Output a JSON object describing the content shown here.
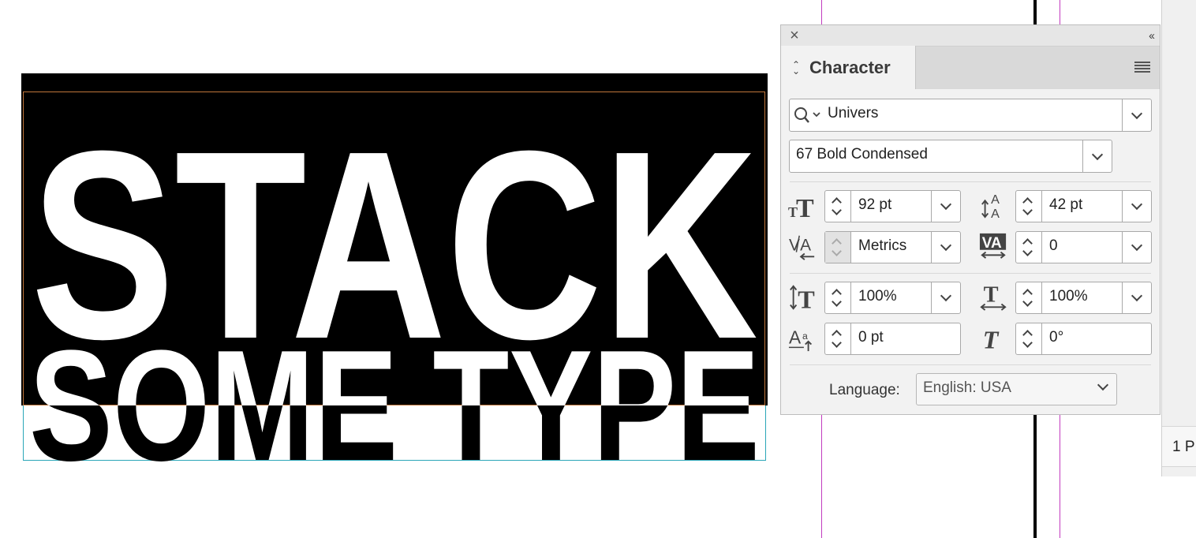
{
  "artwork": {
    "line1": "STACK",
    "line2": "SOME TYPE"
  },
  "pages_panel": {
    "page_count": "1 P"
  },
  "character_panel": {
    "tab_title": "Character",
    "font_family": "Univers",
    "font_style": "67 Bold Condensed",
    "font_size": "92 pt",
    "leading": "42 pt",
    "kerning": "Metrics",
    "tracking": "0",
    "vertical_scale": "100%",
    "horizontal_scale": "100%",
    "baseline_shift": "0 pt",
    "skew": "0°",
    "language_label": "Language:",
    "language": "English: USA"
  },
  "icons": [
    "close-icon",
    "collapse-panel-icon",
    "panel-menu-icon",
    "search-icon",
    "font-size-icon",
    "leading-icon",
    "kerning-icon",
    "tracking-icon",
    "vertical-scale-icon",
    "horizontal-scale-icon",
    "baseline-shift-icon",
    "skew-icon"
  ],
  "colors": {
    "guide_magenta": "#c23cbf",
    "frame_orange": "#c0763c",
    "frame_cyan": "#2aa6b8",
    "panel_bg": "#f2f2f2"
  }
}
